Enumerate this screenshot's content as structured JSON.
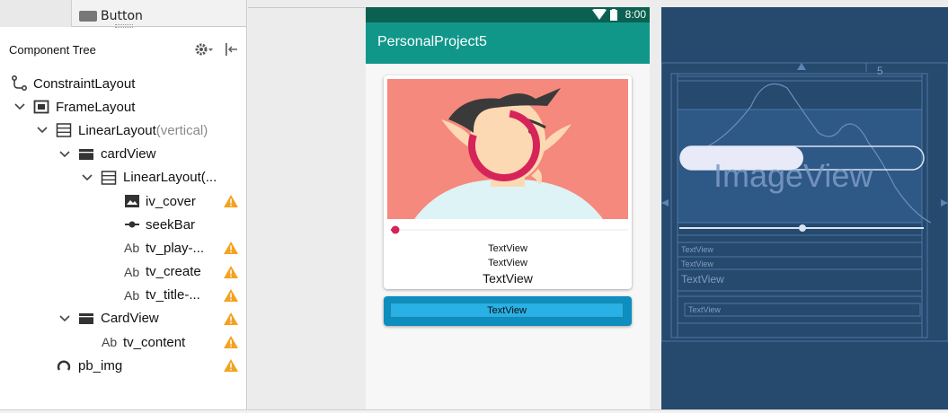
{
  "palette": {
    "button_label": "Button"
  },
  "component_tree": {
    "title": "Component Tree",
    "nodes": [
      {
        "label": "ConstraintLayout",
        "sub": "",
        "icon": "constraint-layout-icon",
        "warn": false
      },
      {
        "label": "FrameLayout",
        "sub": "",
        "icon": "frame-layout-icon",
        "warn": false
      },
      {
        "label": "LinearLayout",
        "sub": "(vertical)",
        "icon": "linear-layout-icon",
        "warn": false
      },
      {
        "label": "cardView",
        "sub": "",
        "icon": "cardview-icon",
        "warn": false
      },
      {
        "label": "LinearLayout(...",
        "sub": "",
        "icon": "linear-layout-icon",
        "warn": false
      },
      {
        "label": "iv_cover",
        "sub": "",
        "icon": "image-view-icon",
        "warn": true
      },
      {
        "label": "seekBar",
        "sub": "",
        "icon": "seekbar-icon",
        "warn": false
      },
      {
        "label": "tv_play-...",
        "sub": "",
        "icon": "textview-icon",
        "warn": true
      },
      {
        "label": "tv_create",
        "sub": "",
        "icon": "textview-icon",
        "warn": true
      },
      {
        "label": "tv_title-...",
        "sub": "",
        "icon": "textview-icon",
        "warn": true
      },
      {
        "label": "CardView",
        "sub": "",
        "icon": "cardview-icon",
        "warn": true
      },
      {
        "label": "tv_content",
        "sub": "",
        "icon": "textview-icon",
        "warn": true
      },
      {
        "label": "pb_img",
        "sub": "",
        "icon": "progressbar-icon",
        "warn": true
      }
    ],
    "icon_text_ab": "Ab"
  },
  "phone": {
    "status_time": "8:00",
    "app_title": "PersonalProject5",
    "card": {
      "tv_play": "TextView",
      "tv_create": "TextView",
      "tv_title": "TextView"
    },
    "card2": {
      "tv_content": "TextView"
    },
    "seek_progress": 0.02
  },
  "blueprint": {
    "image_label": "ImageView",
    "tv1": "TextView",
    "tv2": "TextView",
    "tv3": "TextView",
    "tv4": "TextView",
    "margin_label": "5"
  },
  "colors": {
    "statusbar": "#0b6151",
    "appbar": "#10978a",
    "cover_bg": "#f5897d",
    "progress_ring": "#d6245a",
    "card2": "#0e8ebf",
    "blueprint_bg": "#26496e",
    "warn": "#f4a21f"
  }
}
